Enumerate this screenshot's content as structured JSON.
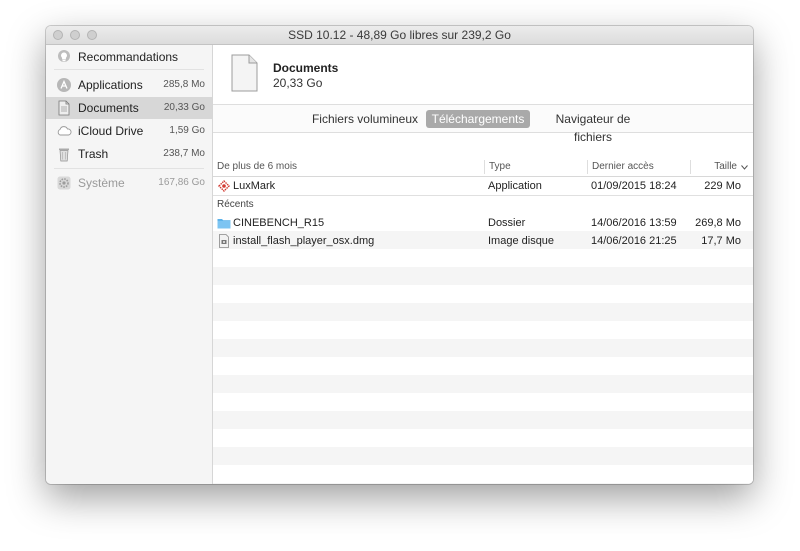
{
  "window": {
    "title": "SSD 10.12 - 48,89 Go libres sur 239,2 Go"
  },
  "sidebar": {
    "items": [
      {
        "label": "Recommandations",
        "size": "",
        "icon": "lightbulb-icon"
      },
      {
        "label": "Applications",
        "size": "285,8 Mo",
        "icon": "app-store-icon"
      },
      {
        "label": "Documents",
        "size": "20,33 Go",
        "icon": "document-icon"
      },
      {
        "label": "iCloud Drive",
        "size": "1,59 Go",
        "icon": "cloud-icon"
      },
      {
        "label": "Trash",
        "size": "238,7 Mo",
        "icon": "trash-icon"
      },
      {
        "label": "Système",
        "size": "167,86 Go",
        "icon": "gear-icon"
      }
    ]
  },
  "header": {
    "title": "Documents",
    "size": "20,33 Go"
  },
  "tabs": [
    {
      "label": "Fichiers volumineux"
    },
    {
      "label": "Téléchargements"
    },
    {
      "label": "Navigateur de fichiers"
    }
  ],
  "columns": {
    "name": "De plus de 6 mois",
    "type": "Type",
    "date": "Dernier accès",
    "size": "Taille"
  },
  "sections": {
    "older": {
      "rows": [
        {
          "name": "LuxMark",
          "type": "Application",
          "date": "01/09/2015 18:24",
          "size": "229 Mo",
          "icon": "luxmark-icon"
        }
      ]
    },
    "recent": {
      "label": "Récents",
      "rows": [
        {
          "name": "CINEBENCH_R15",
          "type": "Dossier",
          "date": "14/06/2016 13:59",
          "size": "269,8 Mo",
          "icon": "folder-icon"
        },
        {
          "name": "install_flash_player_osx.dmg",
          "type": "Image disque",
          "date": "14/06/2016 21:25",
          "size": "17,7 Mo",
          "icon": "disk-image-icon"
        }
      ]
    }
  },
  "colors": {
    "selected_sidebar": "#d7d7d7",
    "active_tab": "#a9a9a9",
    "folder": "#5bb2ea"
  }
}
